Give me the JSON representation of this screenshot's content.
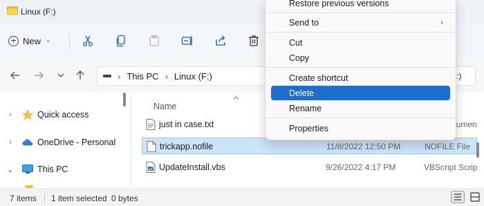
{
  "window": {
    "title": "Linux (F:)"
  },
  "toolbar": {
    "new_label": "New",
    "new_chevron": "⌄"
  },
  "address": {
    "segments": [
      "This PC",
      "Linux (F:)"
    ],
    "separator": "›",
    "search_tail": "):)"
  },
  "nav_pane": {
    "items": [
      {
        "label": "Quick access",
        "chevron": "›",
        "icon": "star-icon"
      },
      {
        "label": "OneDrive - Personal",
        "chevron": "›",
        "icon": "cloud-icon"
      },
      {
        "label": "This PC",
        "chevron": "⌄",
        "icon": "monitor-icon"
      }
    ]
  },
  "file_list": {
    "column_name": "Name",
    "rows": [
      {
        "name": "just in case.txt",
        "date": "",
        "type": "Text Document"
      },
      {
        "name": "trickapp.nofile",
        "date": "11/8/2022 12:50 PM",
        "type": "NOFILE File",
        "selected": true
      },
      {
        "name": "UpdateInstall.vbs",
        "date": "9/26/2022 4:17 PM",
        "type": "VBScript Script File"
      }
    ]
  },
  "status": {
    "items": "7 items",
    "selected": "1 item selected",
    "size": "0 bytes"
  },
  "context_menu": {
    "items": [
      {
        "label": "Restore previous versions"
      },
      {
        "label": "Send to",
        "submenu": "›"
      },
      {
        "label": "Cut"
      },
      {
        "label": "Copy"
      },
      {
        "label": "Create shortcut"
      },
      {
        "label": "Delete",
        "highlighted": true
      },
      {
        "label": "Rename"
      },
      {
        "label": "Properties"
      }
    ]
  },
  "colors": {
    "accent": "#1e6fcc",
    "selection": "#cce4f7",
    "folder": "#f4c430",
    "star": "#f6c342",
    "cloud": "#2c7fd6"
  }
}
